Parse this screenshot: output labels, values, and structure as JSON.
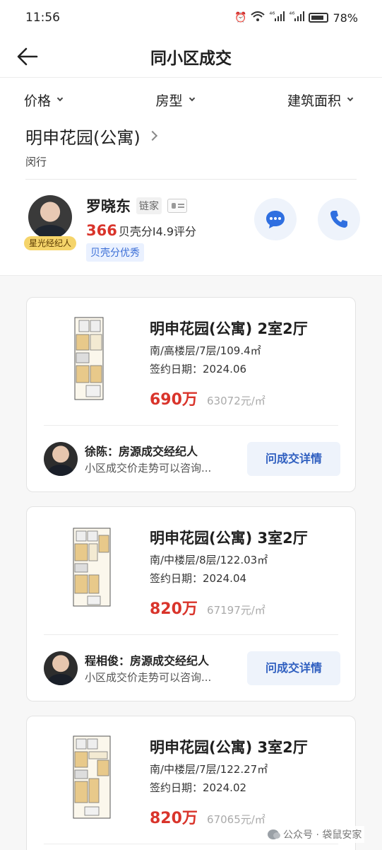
{
  "status_bar": {
    "time": "11:56",
    "network_1": "⁴⁶",
    "network_2": "⁴⁶",
    "battery": "78%"
  },
  "nav": {
    "title": "同小区成交"
  },
  "filters": [
    {
      "label": "价格"
    },
    {
      "label": "房型"
    },
    {
      "label": "建筑面积"
    }
  ],
  "community": {
    "name": "明申花园(公寓)",
    "district": "闵行"
  },
  "agent": {
    "name": "罗晓东",
    "brand": "链家",
    "badge": "星光经纪人",
    "score": "366",
    "score_label": "贝壳分",
    "rating": "I4.9评分",
    "tag": "贝壳分优秀"
  },
  "listings": [
    {
      "title": "明申花园(公寓) 2室2厅",
      "spec": "南/高楼层/7层/109.4㎡",
      "date": "签约日期：2024.06",
      "price": "690万",
      "unit_price": "63072元/㎡",
      "agent_title": "徐陈：房源成交经纪人",
      "agent_desc": "小区成交价走势可以咨询...",
      "button": "问成交详情"
    },
    {
      "title": "明申花园(公寓) 3室2厅",
      "spec": "南/中楼层/8层/122.03㎡",
      "date": "签约日期：2024.04",
      "price": "820万",
      "unit_price": "67197元/㎡",
      "agent_title": "程相俊：房源成交经纪人",
      "agent_desc": "小区成交价走势可以咨询...",
      "button": "问成交详情"
    },
    {
      "title": "明申花园(公寓) 3室2厅",
      "spec": "南/中楼层/7层/122.27㎡",
      "date": "签约日期：2024.02",
      "price": "820万",
      "unit_price": "67065元/㎡"
    }
  ],
  "watermark": "公众号 · 袋鼠安家"
}
